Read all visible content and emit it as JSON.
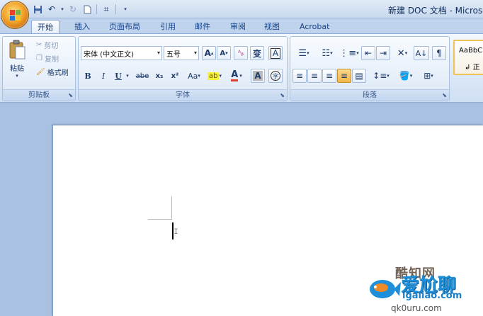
{
  "window": {
    "title": "新建 DOC 文档 - Microso"
  },
  "tabs": [
    "开始",
    "插入",
    "页面布局",
    "引用",
    "邮件",
    "审阅",
    "视图",
    "Acrobat"
  ],
  "clipboard": {
    "label": "剪贴板",
    "paste": "粘贴",
    "cut": "剪切",
    "copy": "复制",
    "format_painter": "格式刷"
  },
  "font": {
    "label": "字体",
    "name": "宋体 (中文正文)",
    "size": "五号",
    "grow": "A",
    "shrink": "A",
    "bold": "B",
    "italic": "I",
    "underline": "U",
    "strike": "abe",
    "subscript": "x₂",
    "superscript": "x²",
    "change_case": "Aa",
    "font_color": "A",
    "char_shade": "A",
    "enclose": "字",
    "phonetic": "变",
    "border": "A"
  },
  "paragraph": {
    "label": "段落"
  },
  "styles": {
    "preview": "AaBbC",
    "name": "正"
  },
  "watermark": {
    "site": "酷知网",
    "brand": "爱尬聊",
    "url": "igaliao.com",
    "url2": "qk0uru.com"
  }
}
